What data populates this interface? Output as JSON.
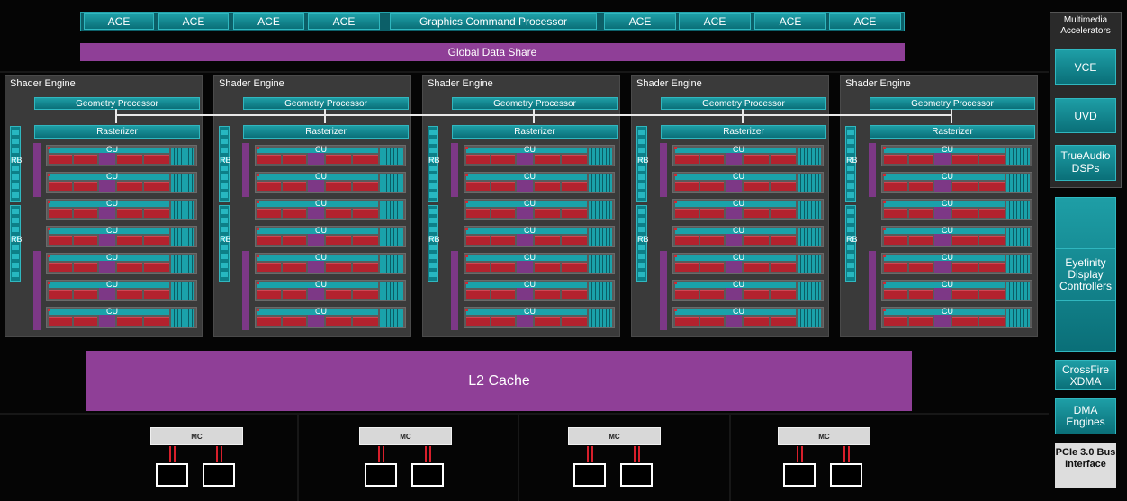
{
  "top_row": {
    "aces_left": [
      "ACE",
      "ACE",
      "ACE",
      "ACE"
    ],
    "command_processor": "Graphics Command Processor",
    "aces_right": [
      "ACE",
      "ACE",
      "ACE",
      "ACE"
    ]
  },
  "global_data_share": "Global Data Share",
  "shader_engines": [
    {
      "title": "Shader Engine",
      "geometry": "Geometry Processor",
      "rasterizer": "Rasterizer",
      "rb": [
        "RB",
        "RB"
      ],
      "cus": [
        "CU",
        "CU",
        "CU",
        "CU",
        "CU",
        "CU",
        "CU"
      ]
    },
    {
      "title": "Shader Engine",
      "geometry": "Geometry Processor",
      "rasterizer": "Rasterizer",
      "rb": [
        "RB",
        "RB"
      ],
      "cus": [
        "CU",
        "CU",
        "CU",
        "CU",
        "CU",
        "CU",
        "CU"
      ]
    },
    {
      "title": "Shader Engine",
      "geometry": "Geometry Processor",
      "rasterizer": "Rasterizer",
      "rb": [
        "RB",
        "RB"
      ],
      "cus": [
        "CU",
        "CU",
        "CU",
        "CU",
        "CU",
        "CU",
        "CU"
      ]
    },
    {
      "title": "Shader Engine",
      "geometry": "Geometry Processor",
      "rasterizer": "Rasterizer",
      "rb": [
        "RB",
        "RB"
      ],
      "cus": [
        "CU",
        "CU",
        "CU",
        "CU",
        "CU",
        "CU",
        "CU"
      ]
    },
    {
      "title": "Shader Engine",
      "geometry": "Geometry Processor",
      "rasterizer": "Rasterizer",
      "rb": [
        "RB",
        "RB"
      ],
      "cus": [
        "CU",
        "CU",
        "CU",
        "CU",
        "CU",
        "CU",
        "CU"
      ]
    }
  ],
  "l2_cache": "L2 Cache",
  "memory_controllers": [
    "MC",
    "MC",
    "MC",
    "MC"
  ],
  "right_panel": {
    "multimedia_title": "Multimedia Accelerators",
    "vce": "VCE",
    "uvd": "UVD",
    "trueaudio": "TrueAudio DSPs",
    "eyefinity": "Eyefinity Display Controllers",
    "crossfire": "CrossFire XDMA",
    "dma": "DMA Engines",
    "pcie": "PCIe 3.0 Bus Interface"
  },
  "colors": {
    "teal": "#1e9ea6",
    "purple": "#8f3f97",
    "red": "#b3222e",
    "engine_bg": "#3a3a3a"
  }
}
